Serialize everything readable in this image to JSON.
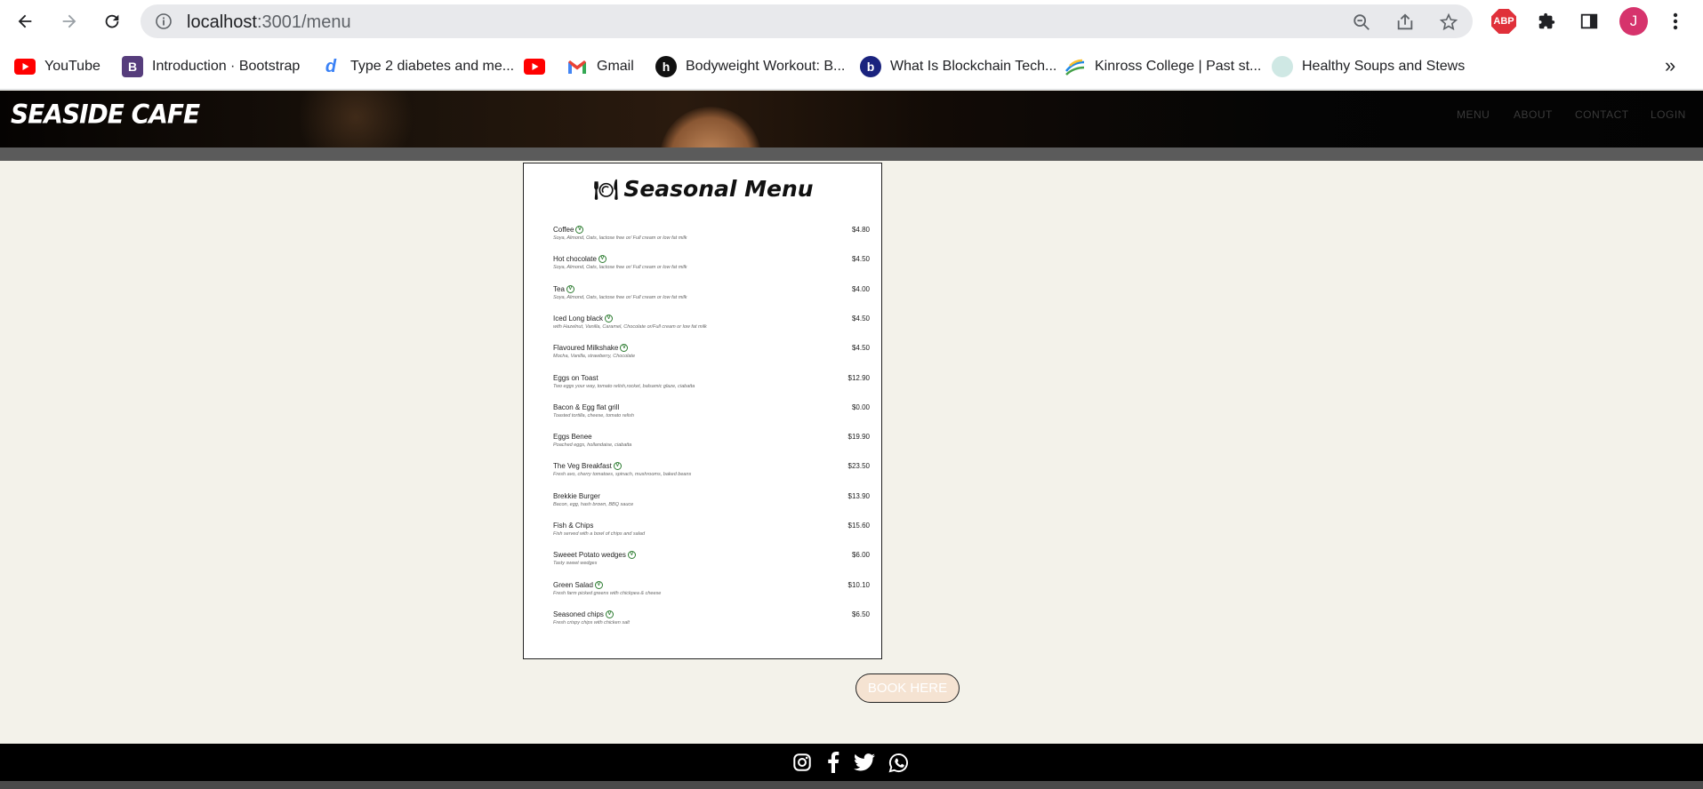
{
  "browser": {
    "url_host": "localhost",
    "url_path": ":3001/menu",
    "avatar_letter": "J",
    "abp_label": "ABP"
  },
  "bookmarks": [
    {
      "label": "YouTube",
      "icon": "youtube-icon"
    },
    {
      "label": "Introduction · Bootstrap",
      "icon": "bootstrap-icon"
    },
    {
      "label": "Type 2 diabetes and me...",
      "icon": "d-icon"
    },
    {
      "label": "",
      "icon": "youtube-icon"
    },
    {
      "label": "Gmail",
      "icon": "gmail-icon"
    },
    {
      "label": "Bodyweight Workout: B...",
      "icon": "h-icon"
    },
    {
      "label": "What Is Blockchain Tech...",
      "icon": "b-icon"
    },
    {
      "label": "Kinross College | Past st...",
      "icon": "kinross-icon"
    },
    {
      "label": "Healthy Soups and Stews",
      "icon": "soup-icon"
    }
  ],
  "site": {
    "brand": "SEASIDE CAFE",
    "nav": [
      "MENU",
      "ABOUT",
      "CONTACT",
      "LOGIN"
    ]
  },
  "menu": {
    "title": "Seasonal Menu",
    "items": [
      {
        "name": "Coffee",
        "vegan": true,
        "desc": "Soya, Almond, Oats, lactose free or/ Full cream or low fat milk",
        "price": "$4.80"
      },
      {
        "name": "Hot chocolate",
        "vegan": true,
        "desc": "Soya, Almond, Oats, lactose free or/ Full cream or low fat milk",
        "price": "$4.50"
      },
      {
        "name": "Tea",
        "vegan": true,
        "desc": "Soya, Almond, Oats, lactose free or/ Full cream or low fat milk",
        "price": "$4.00"
      },
      {
        "name": "Iced Long black",
        "vegan": true,
        "desc": "with Hazelnut, Vanilla, Caramel, Chocolate or/Full cream or low fat milk",
        "price": "$4.50"
      },
      {
        "name": "Flavoured Milkshake",
        "vegan": true,
        "desc": "Mocha, Vanilla, strawberry, Chocolate",
        "price": "$4.50"
      },
      {
        "name": "Eggs on Toast",
        "vegan": false,
        "desc": "Two eggs your way, tomato relish,rocket, balsamic glaze, ciabatta",
        "price": "$12.90"
      },
      {
        "name": "Bacon & Egg flat grill",
        "vegan": false,
        "desc": "Toasted tortilla, cheese, tomato relish",
        "price": "$0.00"
      },
      {
        "name": "Eggs Benee",
        "vegan": false,
        "desc": "Poached eggs, hollandaise, ciabatta",
        "price": "$19.90"
      },
      {
        "name": "The Veg Breakfast",
        "vegan": true,
        "desc": "Fresh avo, cherry tomatoes, spinach, mushrooms, baked beans",
        "price": "$23.50"
      },
      {
        "name": "Brekkie Burger",
        "vegan": false,
        "desc": "Bacon, egg, hash brown, BBQ sauce",
        "price": "$13.90"
      },
      {
        "name": "Fish & Chips",
        "vegan": false,
        "desc": "Fish served with a bowl of chips and salad",
        "price": "$15.60"
      },
      {
        "name": "Sweeet Potato wedges",
        "vegan": true,
        "desc": "Tasty sweet wedges",
        "price": "$6.00"
      },
      {
        "name": "Green Salad",
        "vegan": true,
        "desc": "Fresh farm picked greens with chickpea & cheese",
        "price": "$10.10"
      },
      {
        "name": "Seasoned chips",
        "vegan": true,
        "desc": "Fresh crispy chips with chicken salt",
        "price": "$6.50"
      }
    ]
  },
  "book_button": "BOOK HERE",
  "footer": {
    "social": [
      "instagram-icon",
      "facebook-icon",
      "twitter-icon",
      "whatsapp-icon"
    ]
  },
  "colors": {
    "page_bg": "#f3f2ea",
    "book_bg": "#f5e3d2",
    "vegan_green": "#2e7d32",
    "avatar": "#d6336c",
    "abp": "#e0303a"
  }
}
